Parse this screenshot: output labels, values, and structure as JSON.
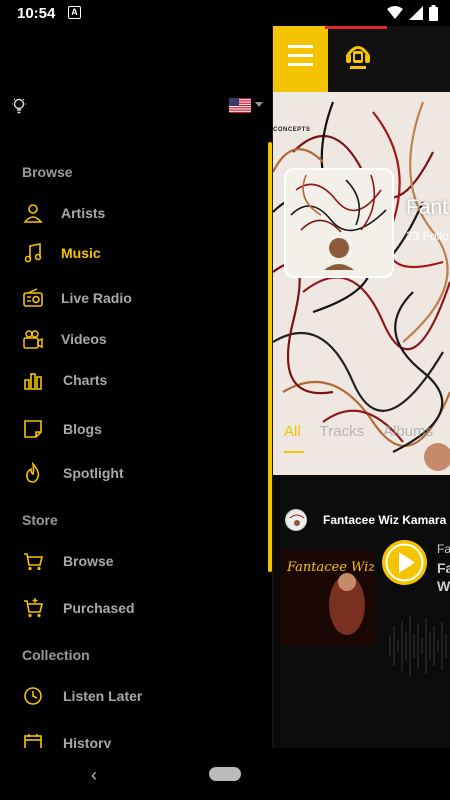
{
  "status": {
    "time": "10:54",
    "a_badge": "A"
  },
  "drawer": {
    "sections": {
      "browse": "Browse",
      "store": "Store",
      "collection": "Collection"
    },
    "items": {
      "artists": "Artists",
      "music": "Music",
      "live_radio": "Live Radio",
      "videos": "Videos",
      "charts": "Charts",
      "blogs": "Blogs",
      "spotlight": "Spotlight",
      "store_browse": "Browse",
      "purchased": "Purchased",
      "listen_later": "Listen Later",
      "history": "History"
    },
    "active_item": "Music",
    "accent_color": "#f5c400"
  },
  "content": {
    "hero_label": "CONCEPTS",
    "hero_name": "Fant",
    "hero_followers": "23 Follo",
    "tabs": [
      "All",
      "Tracks",
      "Albums"
    ],
    "feed_artist": "Fantacee Wiz Kamara",
    "album_title": "Fantacee Wiz",
    "track_line_1": "Fa",
    "track_line_2": "Fa",
    "track_line_3": "W"
  },
  "navigation": {
    "back_glyph": "‹"
  }
}
